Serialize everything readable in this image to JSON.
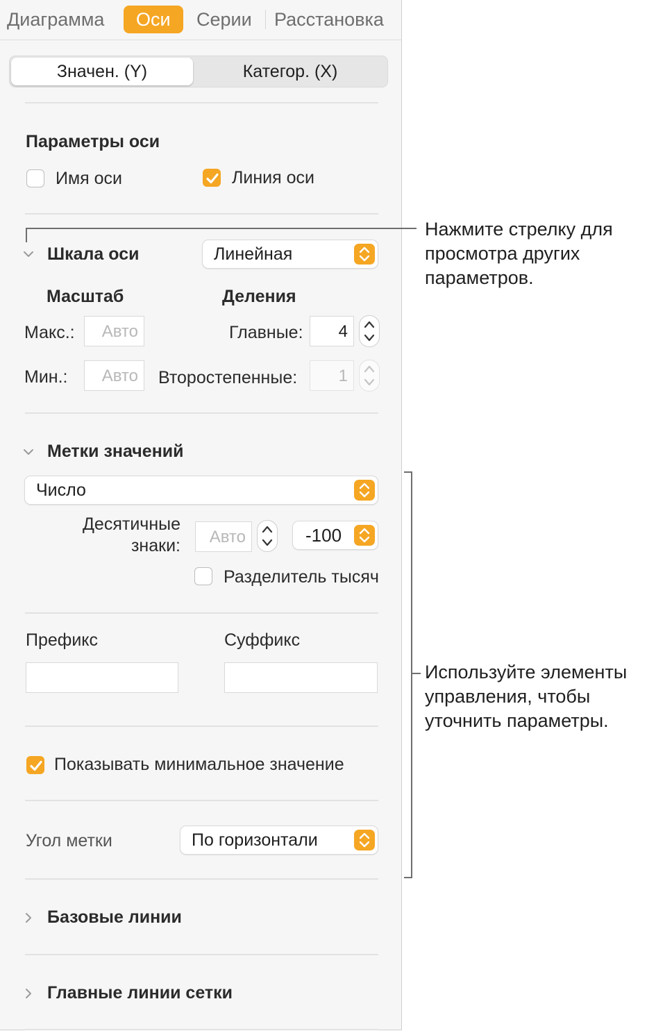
{
  "tabs": {
    "chart": "Диаграмма",
    "axes": "Оси",
    "series": "Серии",
    "arrange": "Расстановка"
  },
  "segmented": {
    "value_y": "Значен. (Y)",
    "category_x": "Категор. (X)"
  },
  "axis_options": {
    "heading": "Параметры оси",
    "axis_name": "Имя оси",
    "axis_name_checked": false,
    "axis_line": "Линия оси",
    "axis_line_checked": true
  },
  "axis_scale": {
    "heading": "Шкала оси",
    "type": "Линейная",
    "scale_heading": "Масштаб",
    "max_label": "Макс.:",
    "max_placeholder": "Авто",
    "min_label": "Мин.:",
    "min_placeholder": "Авто",
    "ticks_heading": "Деления",
    "major_label": "Главные:",
    "major_value": "4",
    "minor_label": "Второстепенные:",
    "minor_value": "1"
  },
  "value_labels": {
    "heading": "Метки значений",
    "format": "Число",
    "decimals_label_1": "Десятичные",
    "decimals_label_2": "знаки:",
    "decimals_placeholder": "Авто",
    "negative_format": "-100",
    "thousands_separator": "Разделитель тысяч",
    "thousands_separator_checked": false,
    "prefix_label": "Префикс",
    "prefix_value": "",
    "suffix_label": "Суффикс",
    "suffix_value": "",
    "show_min_value": "Показывать минимальное значение",
    "show_min_value_checked": true,
    "label_angle_label": "Угол метки",
    "label_angle_value": "По горизонтали"
  },
  "sections": {
    "baselines": "Базовые линии",
    "major_gridlines": "Главные линии сетки"
  },
  "callouts": {
    "arrow_line1": "Нажмите стрелку для",
    "arrow_line2": "просмотра других",
    "arrow_line3": "параметров.",
    "controls_line1": "Используйте элементы",
    "controls_line2": "управления, чтобы",
    "controls_line3": "уточнить параметры."
  },
  "colors": {
    "accent": "#f5a623",
    "panel_bg": "#f6f6f6"
  },
  "icons": {
    "disclosure_open": "chevron-down-icon",
    "disclosure_closed": "chevron-right-icon",
    "popup": "up-down-arrows-icon",
    "stepper": "stepper-icon",
    "checkmark": "checkmark-icon"
  }
}
